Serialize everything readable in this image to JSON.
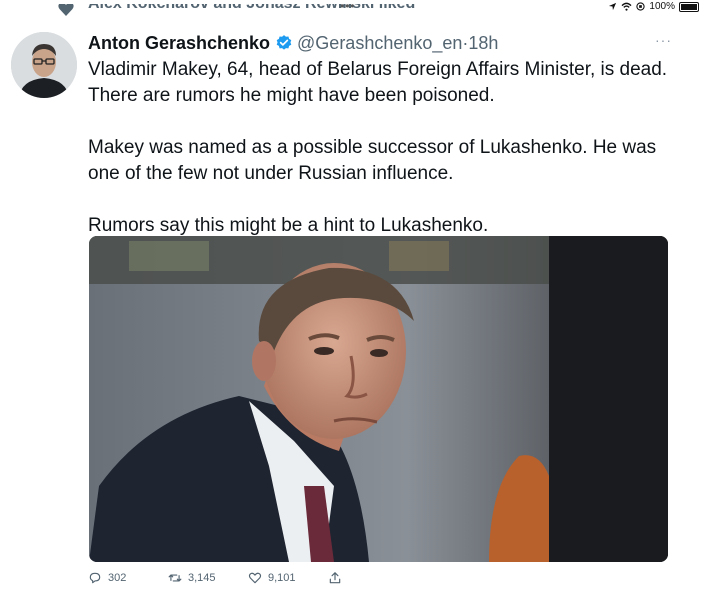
{
  "statusbar": {
    "dots": "•••",
    "battery": "100%"
  },
  "liked_banner": {
    "text": "Alex Kokcharov and Jonasz Rewinski liked"
  },
  "tweet": {
    "author_name": "Anton Gerashchenko",
    "handle": "@Gerashchenko_en",
    "separator": "·",
    "time": "18h",
    "more": "···",
    "paragraphs": [
      "Vladimir Makey, 64, head of Belarus Foreign Affairs Minister, is dead. There are rumors he might have been poisoned.",
      "Makey was named as a possible successor of Lukashenko. He was one of the few not under Russian influence.",
      "Rumors say this might be a hint to Lukashenko."
    ]
  },
  "actions": {
    "replies": "302",
    "retweets": "3,145",
    "likes": "9,101"
  },
  "icons": {
    "verified": "verified-badge-icon",
    "reply": "reply-icon",
    "retweet": "retweet-icon",
    "like": "heart-icon",
    "share": "share-icon"
  },
  "colors": {
    "verified": "#1d9bf0",
    "secondary_text": "#536471",
    "text": "#0f1419"
  }
}
